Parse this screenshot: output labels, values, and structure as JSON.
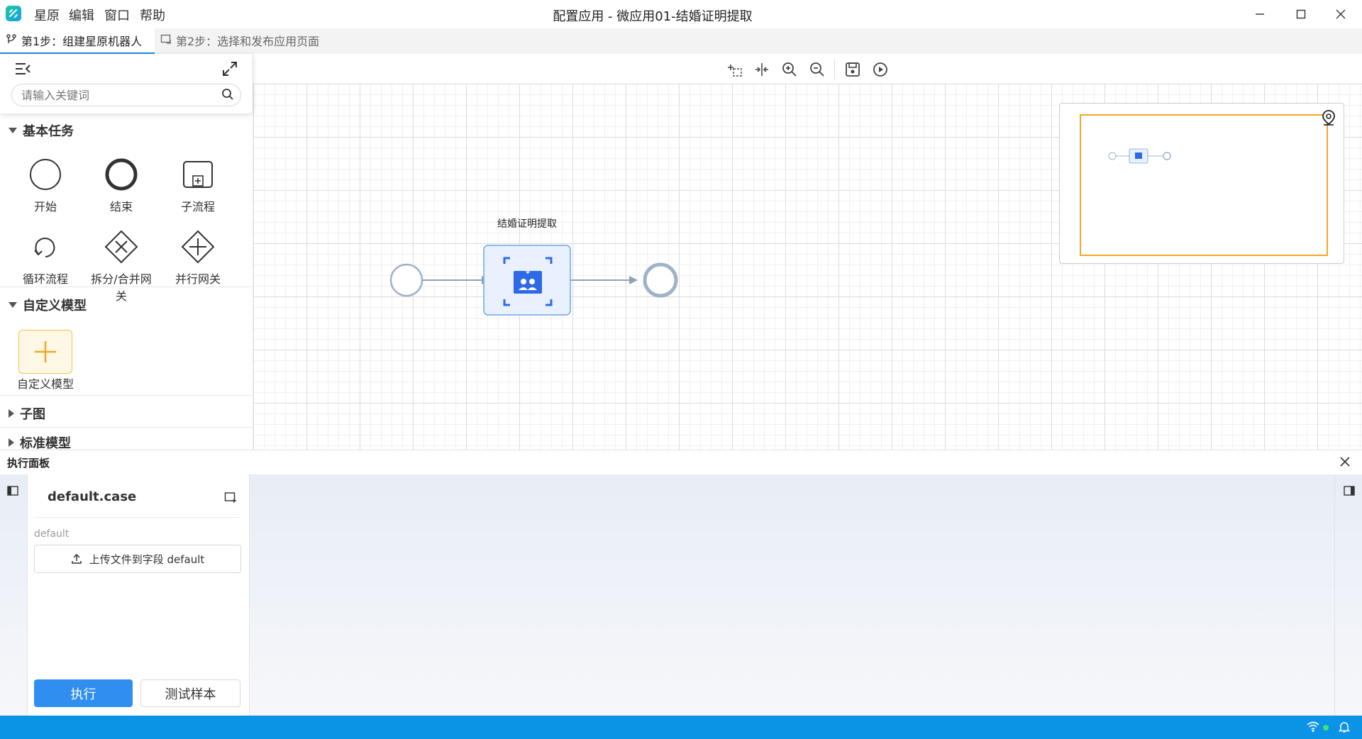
{
  "menu": [
    "星原",
    "编辑",
    "窗口",
    "帮助"
  ],
  "window_title": "配置应用 - 微应用01-结婚证明提取",
  "steps": {
    "step1": "第1步：组建星原机器人",
    "step2": "第2步：选择和发布应用页面"
  },
  "search": {
    "placeholder": "请输入关键词"
  },
  "sections": {
    "basic": "基本任务",
    "custom": "自定义模型",
    "subgraph": "子图",
    "standard": "标准模型"
  },
  "basic_tools": [
    "开始",
    "结束",
    "子流程",
    "循环流程",
    "拆分/合并网关",
    "并行网关"
  ],
  "custom_tool": "自定义模型",
  "flow": {
    "task_label": "结婚证明提取"
  },
  "exec_panel": {
    "title": "执行面板",
    "case_name": "default.case",
    "field_label": "default",
    "upload_label": "上传文件到字段 default",
    "run_label": "执行",
    "sample_label": "测试样本"
  },
  "colors": {
    "accent": "#2f8ef0",
    "status_bar": "#0b93e6",
    "minimap_frame": "#f5a623",
    "node_stroke": "#9fb3c8"
  }
}
